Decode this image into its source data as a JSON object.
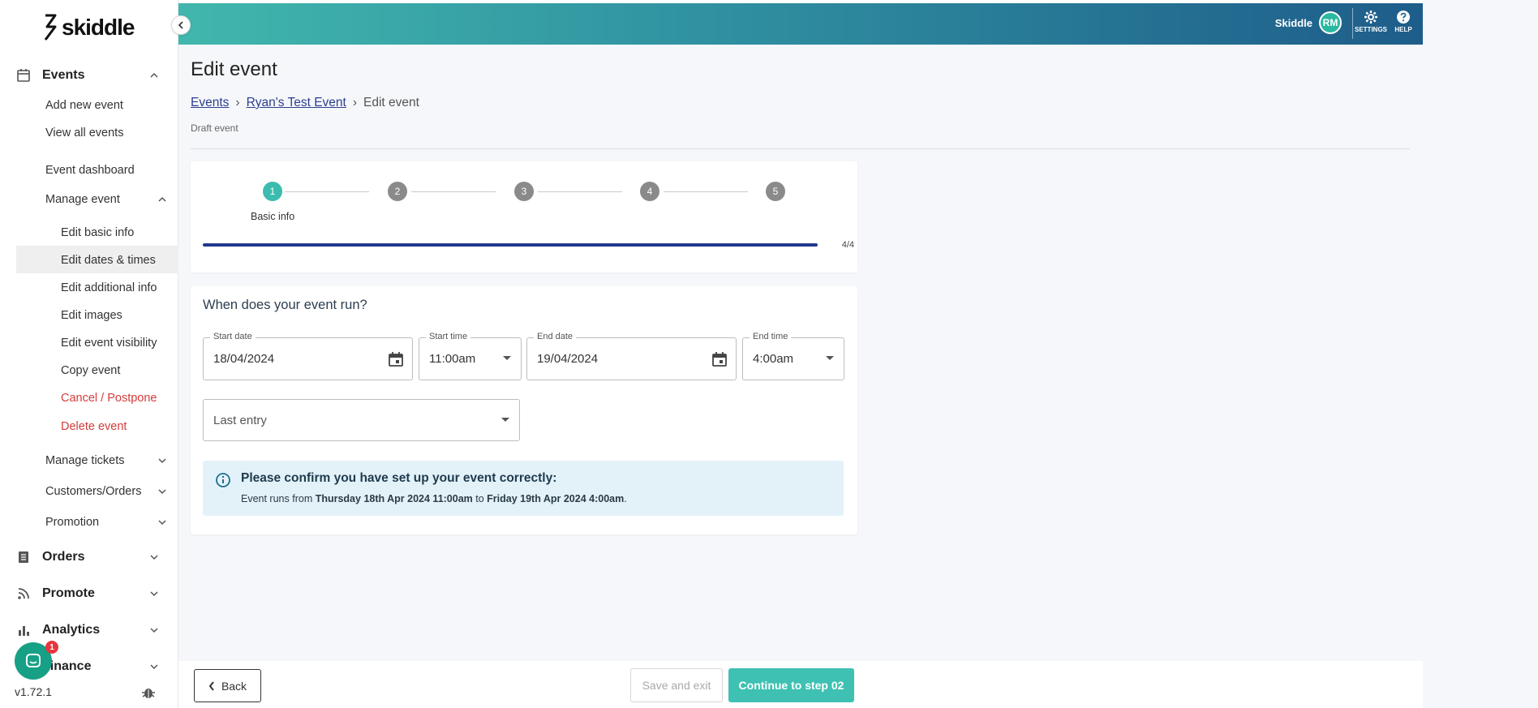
{
  "app": {
    "logo_text": "skiddle",
    "version": "v1.72.1"
  },
  "header": {
    "user_name": "Skiddle",
    "avatar_initials": "RM",
    "settings_label": "SETTINGS",
    "help_label": "HELP"
  },
  "sidebar": {
    "events_label": "Events",
    "add_new_event": "Add new event",
    "view_all_events": "View all events",
    "event_dashboard": "Event dashboard",
    "manage_event": "Manage event",
    "manage_items": [
      "Edit basic info",
      "Edit dates & times",
      "Edit additional info",
      "Edit images",
      "Edit event visibility",
      "Copy event",
      "Cancel / Postpone",
      "Delete event"
    ],
    "manage_tickets": "Manage tickets",
    "customers_orders": "Customers/Orders",
    "promotion": "Promotion",
    "orders_label": "Orders",
    "promote_label": "Promote",
    "analytics_label": "Analytics",
    "finance_label": "Finance",
    "chat_badge_count": "1"
  },
  "page": {
    "title": "Edit event",
    "breadcrumb": [
      "Events",
      "Ryan's Test Event",
      "Edit event"
    ],
    "status": "Draft event"
  },
  "stepper": {
    "steps": [
      "1",
      "2",
      "3",
      "4",
      "5"
    ],
    "active_label": "Basic info",
    "progress_text": "4/4",
    "progress_fraction": 1.0
  },
  "form": {
    "title": "When does your event run?",
    "start_date_label": "Start date",
    "start_date": "18/04/2024",
    "start_time_label": "Start time",
    "start_time": "11:00am",
    "end_date_label": "End date",
    "end_date": "19/04/2024",
    "end_time_label": "End time",
    "end_time": "4:00am",
    "last_entry_placeholder": "Last entry"
  },
  "notice": {
    "title": "Please confirm you have set up your event correctly:",
    "prefix": "Event runs from ",
    "start": "Thursday 18th Apr 2024 11:00am",
    "middle": " to ",
    "end": "Friday 19th Apr 2024 4:00am",
    "suffix": "."
  },
  "footer": {
    "back_label": "Back",
    "save_exit_label": "Save and exit",
    "continue_label": "Continue to step 02"
  },
  "colors": {
    "accent": "#3ec1b3",
    "progress": "#1f3a8a",
    "danger": "#d63b3b",
    "info_bg": "#e3f2f9"
  }
}
